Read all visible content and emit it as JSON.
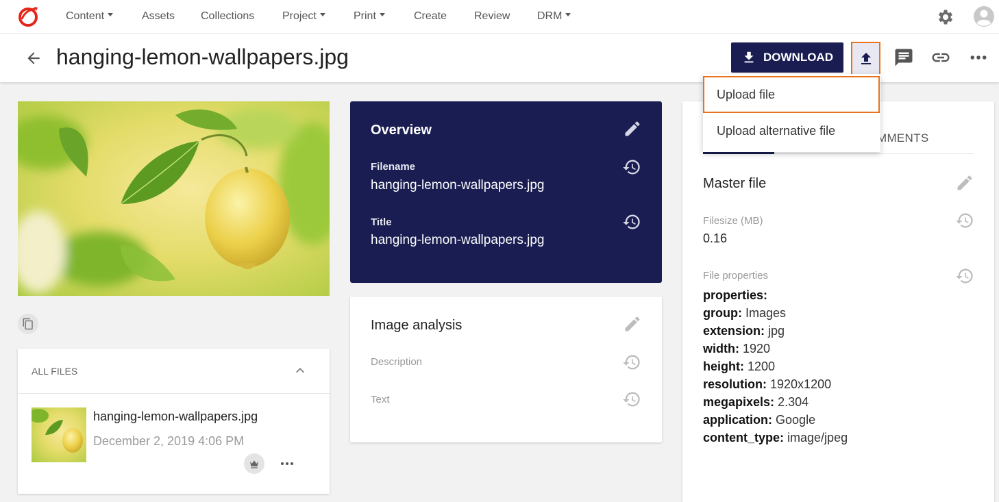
{
  "nav": {
    "items": [
      {
        "label": "Content",
        "dropdown": true
      },
      {
        "label": "Assets",
        "dropdown": false
      },
      {
        "label": "Collections",
        "dropdown": false
      },
      {
        "label": "Project",
        "dropdown": true
      },
      {
        "label": "Print",
        "dropdown": true
      },
      {
        "label": "Create",
        "dropdown": false
      },
      {
        "label": "Review",
        "dropdown": false
      },
      {
        "label": "DRM",
        "dropdown": true
      }
    ],
    "icons": [
      "logo-icon",
      "gear-icon",
      "avatar-icon"
    ]
  },
  "header": {
    "title": "hanging-lemon-wallpapers.jpg",
    "download_label": "DOWNLOAD",
    "icons": [
      "back-arrow-icon",
      "download-icon",
      "upload-icon",
      "comment-icon",
      "link-icon",
      "more-icon"
    ]
  },
  "upload_menu": {
    "items": [
      "Upload file",
      "Upload alternative file"
    ]
  },
  "all_files": {
    "title": "ALL FILES",
    "file": {
      "name": "hanging-lemon-wallpapers.jpg",
      "date": "December 2, 2019 4:06 PM"
    }
  },
  "overview": {
    "title": "Overview",
    "fields": [
      {
        "label": "Filename",
        "value": "hanging-lemon-wallpapers.jpg"
      },
      {
        "label": "Title",
        "value": "hanging-lemon-wallpapers.jpg"
      }
    ]
  },
  "image_analysis": {
    "title": "Image analysis",
    "fields": [
      {
        "label": "Description"
      },
      {
        "label": "Text"
      }
    ]
  },
  "master_file": {
    "tab_visible": "MMENTS",
    "title": "Master file",
    "filesize_label": "Filesize (MB)",
    "filesize_value": "0.16",
    "props_label": "File properties",
    "props_header": "properties:",
    "props": [
      {
        "key": "group:",
        "value": "Images"
      },
      {
        "key": "extension:",
        "value": "jpg"
      },
      {
        "key": "width:",
        "value": "1920"
      },
      {
        "key": "height:",
        "value": "1200"
      },
      {
        "key": "resolution:",
        "value": "1920x1200"
      },
      {
        "key": "megapixels:",
        "value": "2.304"
      },
      {
        "key": "application:",
        "value": "Google"
      },
      {
        "key": "content_type:",
        "value": "image/jpeg"
      }
    ]
  },
  "colors": {
    "navy": "#1a1d52",
    "highlight_orange": "#e8731c",
    "brand_red": "#e3261a"
  }
}
